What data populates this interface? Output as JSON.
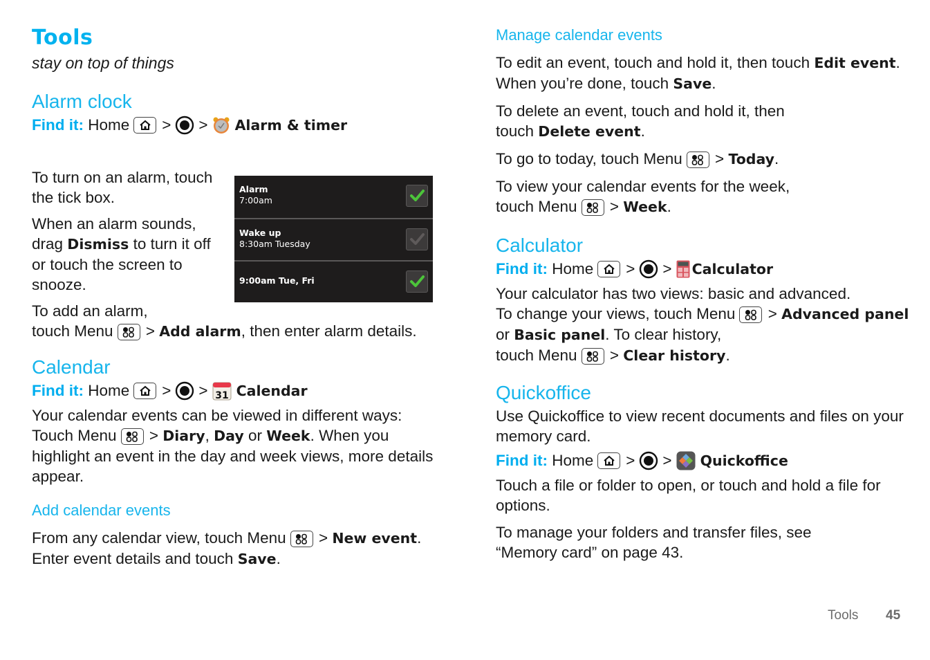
{
  "page": {
    "title": "Tools",
    "tagline": "stay on top of things",
    "footer_section": "Tools",
    "footer_page_number": "45"
  },
  "colors": {
    "accent": "#00aeef",
    "text": "#1a1a1a",
    "alarm_panel_bg": "#1e1c1c",
    "check_on": "#4cc43a",
    "check_off": "#5e5a5a"
  },
  "icons": {
    "home_key": "home-icon",
    "launcher": "launcher-circle-icon",
    "menu_key": "menu-key-icon",
    "alarm_app": "alarm-clock-icon",
    "calendar_app": "calendar-icon",
    "calculator_app": "calculator-icon",
    "quickoffice_app": "quickoffice-icon"
  },
  "common": {
    "find_it": "Find it:",
    "home": "Home",
    "gt": ">",
    "menu": "Menu"
  },
  "alarm_clock": {
    "heading": "Alarm clock",
    "app_name": "Alarm & timer",
    "p1": "To turn on an alarm, touch the tick box.",
    "p2_a": "When an alarm sounds, drag ",
    "p2_b": "Dismiss",
    "p2_c": " to turn it off or touch the screen to snooze.",
    "p3_a": "To add an alarm,",
    "p3_b": "touch Menu",
    "p3_c": "Add alarm",
    "p3_d": ", then enter alarm details.",
    "alarms": [
      {
        "name": "Alarm",
        "time": "7:00am",
        "enabled": true
      },
      {
        "name": "Wake up",
        "time": "8:30am Tuesday",
        "enabled": false
      },
      {
        "name": "",
        "time": "9:00am Tue, Fri",
        "enabled": true
      }
    ]
  },
  "calendar": {
    "heading": "Calendar",
    "app_name": "Calendar",
    "icon_day": "31",
    "p1_a": "Your calendar events can be viewed in different ways: Touch Menu",
    "p1_b": "Diary",
    "p1_c": ", ",
    "p1_d": "Day",
    "p1_e": " or ",
    "p1_f": "Week",
    "p1_g": ". When you highlight an event in the day and week views, more details appear.",
    "add_heading": "Add calendar events",
    "add_a": "From any calendar view, touch Menu",
    "add_b": "New event",
    "add_c": ". Enter event details and touch ",
    "add_d": "Save",
    "add_e": "."
  },
  "manage": {
    "heading": "Manage calendar events",
    "edit_a": "To edit an event, touch and hold it, then touch ",
    "edit_b": "Edit event",
    "edit_c": ". When you’re done, touch ",
    "edit_d": "Save",
    "edit_e": ".",
    "delete_a": "To delete an event, touch and hold it, then",
    "delete_b": "touch ",
    "delete_c": "Delete event",
    "delete_d": ".",
    "today_a": "To go to today, touch Menu",
    "today_b": "Today",
    "today_c": ".",
    "week_a": "To view your calendar events for the week,",
    "week_b": "touch Menu",
    "week_c": "Week",
    "week_d": "."
  },
  "calculator": {
    "heading": "Calculator",
    "app_name": "Calculator",
    "p1": "Your calculator has two views: basic and advanced.",
    "p2_a": "To change your views, touch Menu",
    "p2_b": "Advanced panel",
    "p2_c": " or ",
    "p2_d": "Basic panel",
    "p2_e": ". To clear history,",
    "p2_f": "touch Menu",
    "p2_g": "Clear history",
    "p2_h": "."
  },
  "quickoffice": {
    "heading": "Quickoffice",
    "app_name": "Quickoffice",
    "p1": "Use Quickoffice to view recent documents and files on your memory card.",
    "p2": "Touch a file or folder to open, or touch and hold a file for options.",
    "p3_a": "To manage your folders and transfer files, see",
    "p3_b": "“Memory card” on page 43."
  }
}
